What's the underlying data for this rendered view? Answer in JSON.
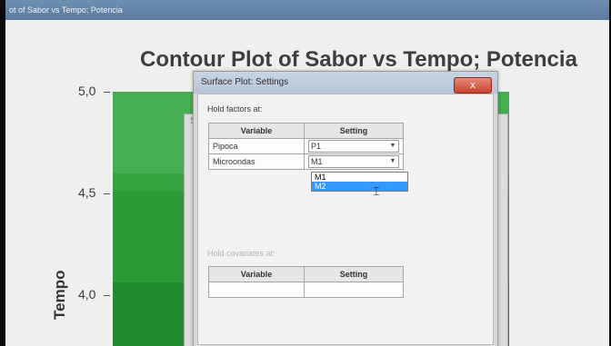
{
  "window": {
    "title": "ot of Sabor vs Tempo; Potencia"
  },
  "chart": {
    "title": "Contour Plot of Sabor vs Tempo; Potencia",
    "ylabel": "Tempo",
    "yticks": [
      "5,0",
      "4,5",
      "4,0"
    ]
  },
  "chart_data": {
    "type": "heatmap",
    "title": "Contour Plot of Sabor vs Tempo; Potencia",
    "ylabel": "Tempo",
    "ytick_labels": [
      "5,0",
      "4,5",
      "4,0"
    ],
    "colors": [
      "#47ad52",
      "#34a340",
      "#2c9a39",
      "#1f8a2e"
    ]
  },
  "back_dialog": {
    "title_fragment": "S"
  },
  "dialog": {
    "title": "Surface Plot: Settings",
    "close_label": "x",
    "hold_factors_label": "Hold factors at:",
    "table": {
      "headers": [
        "Variable",
        "Setting"
      ],
      "rows": [
        {
          "variable": "Pipoca",
          "setting": "P1"
        },
        {
          "variable": "Microondas",
          "setting": "M1"
        }
      ]
    },
    "dropdown_options": [
      "M1",
      "M2"
    ],
    "dropdown_selected": "M2",
    "hold_covariates_label": "Hold covariates at:",
    "covariates_table": {
      "headers": [
        "Variable",
        "Setting"
      ]
    }
  },
  "colors": {
    "accent_selection": "#3399ff",
    "close_button": "#c9412f"
  }
}
